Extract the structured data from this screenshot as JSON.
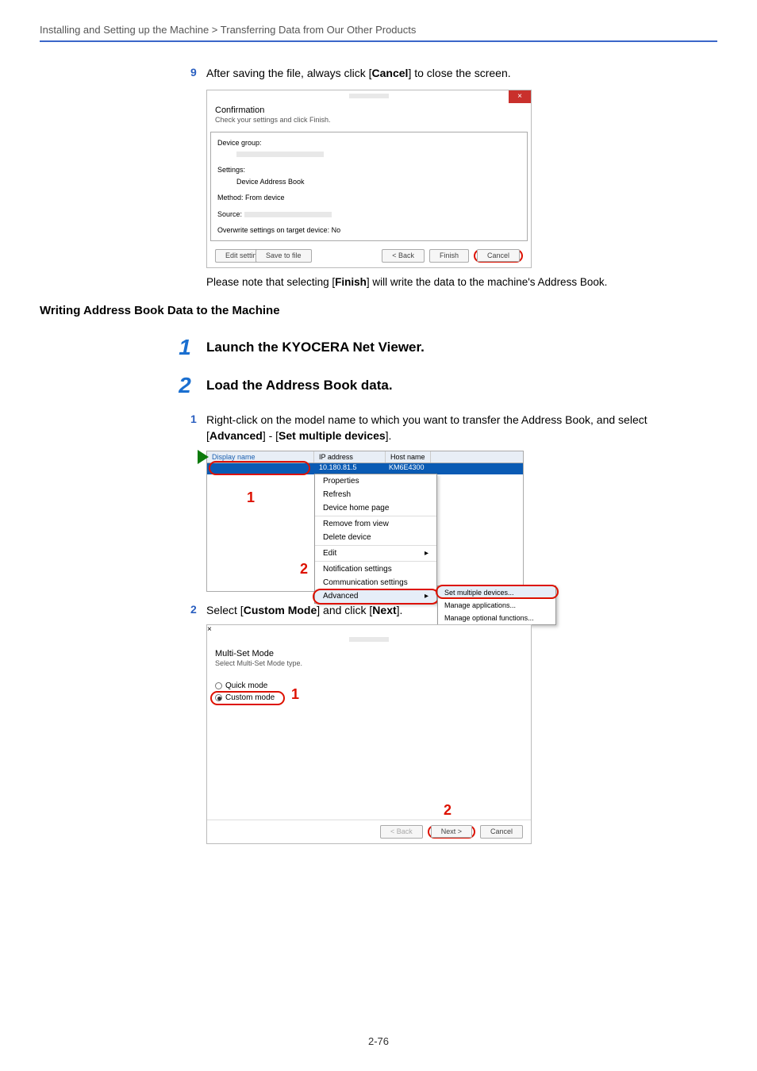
{
  "breadcrumb": "Installing and Setting up the Machine > Transferring Data from Our Other Products",
  "step9": {
    "num": "9",
    "text_pre": "After saving the file, always click [",
    "text_bold": "Cancel",
    "text_post": "] to close the screen."
  },
  "dialog1": {
    "title": "Confirmation",
    "subtitle": "Check your settings and click Finish.",
    "labels": {
      "device_group": "Device group:",
      "settings": "Settings:",
      "settings_val": "Device Address Book",
      "method": "Method: From device",
      "source": "Source:",
      "overwrite": "Overwrite settings on target device: No"
    },
    "buttons": {
      "edit": "Edit settings",
      "save": "Save to file",
      "back": "< Back",
      "finish": "Finish",
      "cancel": "Cancel"
    }
  },
  "note_line_pre": "Please note that selecting [",
  "note_line_bold": "Finish",
  "note_line_post": "] will write the data to the machine's Address Book.",
  "heading2": "Writing Address Book Data to the Machine",
  "bigstep1": {
    "num": "1",
    "text": "Launch the KYOCERA Net Viewer."
  },
  "bigstep2": {
    "num": "2",
    "text": "Load the Address Book data."
  },
  "sub1": {
    "num": "1",
    "pre": "Right-click on the model name to which you want to transfer the Address Book, and select [",
    "b1": "Advanced",
    "mid": "] - [",
    "b2": "Set multiple devices",
    "post": "]."
  },
  "contextmenu": {
    "cols": {
      "display": "Display name",
      "ip": "IP address",
      "host": "Host name"
    },
    "row": {
      "ip": "10.180.81.5",
      "host": "KM6E4300"
    },
    "items": [
      "Properties",
      "Refresh",
      "Device home page",
      "Remove from view",
      "Delete device",
      "Edit",
      "Notification settings",
      "Communication settings",
      "Advanced"
    ],
    "sub_items": [
      "Set multiple devices...",
      "Manage applications...",
      "Manage optional functions..."
    ],
    "annot1": "1",
    "annot2": "2"
  },
  "sub2": {
    "num": "2",
    "pre": "Select [",
    "b1": "Custom Mode",
    "mid": "] and click [",
    "b2": "Next",
    "post": "]."
  },
  "dialog2": {
    "title": "Multi-Set Mode",
    "subtitle": "Select Multi-Set Mode type.",
    "quick": "Quick mode",
    "custom": "Custom mode",
    "annot1": "1",
    "annot2": "2",
    "back": "< Back",
    "next": "Next >",
    "cancel": "Cancel"
  },
  "page_number": "2-76"
}
